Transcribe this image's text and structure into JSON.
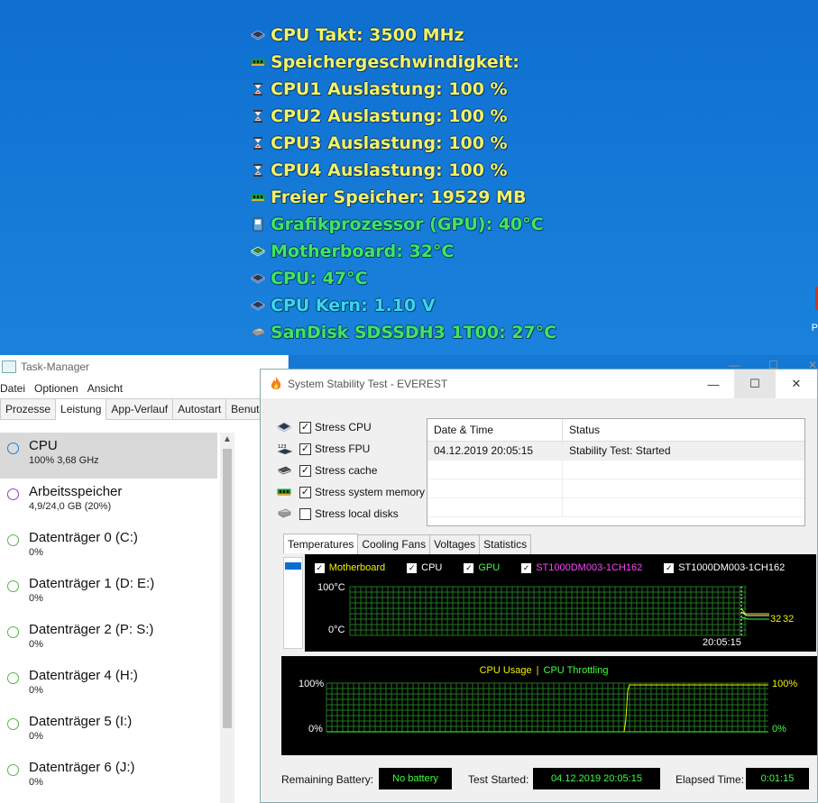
{
  "gadget": {
    "rows": [
      {
        "icon": "cpu-chip-icon",
        "text": "CPU Takt: 3500 MHz",
        "color": "#f2f266"
      },
      {
        "icon": "memory-icon",
        "text": "Speichergeschwindigkeit:",
        "color": "#f2f266"
      },
      {
        "icon": "hourglass-icon",
        "text": "CPU1 Auslastung: 100 %",
        "color": "#f2f266"
      },
      {
        "icon": "hourglass-icon",
        "text": "CPU2 Auslastung: 100 %",
        "color": "#f2f266"
      },
      {
        "icon": "hourglass-icon",
        "text": "CPU3 Auslastung: 100 %",
        "color": "#f2f266"
      },
      {
        "icon": "hourglass-icon",
        "text": "CPU4 Auslastung: 100 %",
        "color": "#f2f266"
      },
      {
        "icon": "memory-icon",
        "text": "Freier Speicher: 19529 MB",
        "color": "#f2f266"
      },
      {
        "icon": "gpu-icon",
        "text": "Grafikprozessor (GPU): 40°C",
        "color": "#3ee660"
      },
      {
        "icon": "motherboard-icon",
        "text": "Motherboard: 32°C",
        "color": "#3ee660"
      },
      {
        "icon": "cpu-chip-icon",
        "text": "CPU: 47°C",
        "color": "#3ee660"
      },
      {
        "icon": "cpu-chip-icon",
        "text": "CPU Kern: 1.10 V",
        "color": "#38d8e8"
      },
      {
        "icon": "disk-icon",
        "text": "SanDisk SDSSDH3 1T00: 27°C",
        "color": "#3ee660"
      }
    ],
    "edge_letter": "P"
  },
  "taskmanager": {
    "title": "Task-Manager",
    "menu": [
      "Datei",
      "Optionen",
      "Ansicht"
    ],
    "tabs": [
      "Prozesse",
      "Leistung",
      "App-Verlauf",
      "Autostart",
      "Benutz"
    ],
    "active_tab": "Leistung",
    "items": [
      {
        "name": "CPU",
        "sub": "100% 3,68 GHz",
        "color": "#1b7fd6",
        "selected": true
      },
      {
        "name": "Arbeitsspeicher",
        "sub": "4,9/24,0 GB (20%)",
        "color": "#9b3dbf",
        "selected": false
      },
      {
        "name": "Datenträger 0 (C:)",
        "sub": "0%",
        "color": "#5ab54c",
        "selected": false
      },
      {
        "name": "Datenträger 1 (D: E:)",
        "sub": "0%",
        "color": "#5ab54c",
        "selected": false
      },
      {
        "name": "Datenträger 2 (P: S:)",
        "sub": "0%",
        "color": "#5ab54c",
        "selected": false
      },
      {
        "name": "Datenträger 4 (H:)",
        "sub": "0%",
        "color": "#5ab54c",
        "selected": false
      },
      {
        "name": "Datenträger 5 (I:)",
        "sub": "0%",
        "color": "#5ab54c",
        "selected": false
      },
      {
        "name": "Datenträger 6 (J:)",
        "sub": "0%",
        "color": "#5ab54c",
        "selected": false
      }
    ]
  },
  "everest": {
    "title": "System Stability Test - EVEREST",
    "stress": [
      {
        "label": "Stress CPU",
        "checked": true,
        "icon": "cpu-chip-icon"
      },
      {
        "label": "Stress FPU",
        "checked": true,
        "icon": "fpu-icon"
      },
      {
        "label": "Stress cache",
        "checked": true,
        "icon": "cache-chip-icon"
      },
      {
        "label": "Stress system memory",
        "checked": true,
        "icon": "memory-icon"
      },
      {
        "label": "Stress local disks",
        "checked": false,
        "icon": "disk-icon"
      }
    ],
    "log": {
      "headers": [
        "Date & Time",
        "Status"
      ],
      "rows": [
        [
          "04.12.2019 20:05:15",
          "Stability Test: Started"
        ]
      ]
    },
    "tabs": [
      "Temperatures",
      "Cooling Fans",
      "Voltages",
      "Statistics"
    ],
    "active_tab": "Temperatures",
    "temp_chart": {
      "legend": [
        {
          "label": "Motherboard",
          "color": "#f2f200"
        },
        {
          "label": "CPU",
          "color": "#ffffff"
        },
        {
          "label": "GPU",
          "color": "#3eff3e"
        },
        {
          "label": "ST1000DM003-1CH162",
          "color": "#ff44ff"
        },
        {
          "label": "ST1000DM003-1CH162",
          "color": "#ffffff"
        }
      ],
      "y_top": "100°C",
      "y_bottom": "0°C",
      "time_label": "20:05:15",
      "value_label_1": "32",
      "value_label_2": "32"
    },
    "cpu_chart": {
      "title_left": "CPU Usage",
      "sep": "|",
      "title_right": "CPU Throttling",
      "y_top_left": "100%",
      "y_bottom_left": "0%",
      "y_top_right": "100%",
      "y_bottom_right": "0%"
    },
    "bottom": {
      "battery_label": "Remaining Battery:",
      "battery_value": "No battery",
      "started_label": "Test Started:",
      "started_value": "04.12.2019 20:05:15",
      "elapsed_label": "Elapsed Time:",
      "elapsed_value": "0:01:15"
    }
  }
}
